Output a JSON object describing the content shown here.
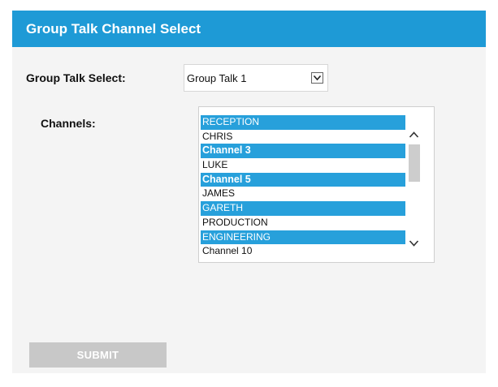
{
  "header": {
    "title": "Group Talk Channel Select"
  },
  "group_talk": {
    "label": "Group Talk Select:",
    "selected": "Group Talk 1"
  },
  "channels": {
    "label": "Channels:",
    "items": [
      {
        "label": "RECEPTION",
        "selected": true
      },
      {
        "label": "CHRIS",
        "selected": false
      },
      {
        "label": "Channel 3",
        "selected": true
      },
      {
        "label": "LUKE",
        "selected": false
      },
      {
        "label": "Channel 5",
        "selected": true
      },
      {
        "label": "JAMES",
        "selected": false
      },
      {
        "label": "GARETH",
        "selected": true
      },
      {
        "label": "PRODUCTION",
        "selected": false
      },
      {
        "label": "ENGINEERING",
        "selected": true
      },
      {
        "label": "Channel 10",
        "selected": false
      }
    ]
  },
  "submit": {
    "label": "SUBMIT"
  },
  "colors": {
    "accent": "#1e9ad6",
    "selection": "#27a0db",
    "disabled_button": "#c8c8c8"
  }
}
